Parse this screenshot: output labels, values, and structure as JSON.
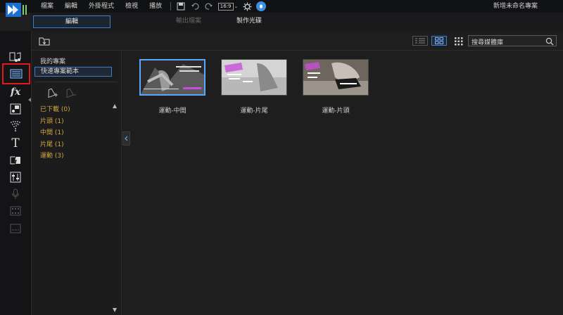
{
  "menubar": {
    "items": [
      "檔案",
      "編輯",
      "外掛程式",
      "檢視",
      "播放"
    ],
    "zoom_label": "16:9",
    "project_title": "新增未命名專案"
  },
  "modes": [
    "編輯",
    "輸出檔案",
    "製作光碟"
  ],
  "rail": {
    "icons": [
      "media-room-icon",
      "template-room-icon",
      "fx-room-icon",
      "pip-room-icon",
      "particle-room-icon",
      "title-room-icon",
      "transition-room-icon",
      "audio-mixing-room-icon",
      "voiceover-room-icon",
      "chapter-room-icon",
      "subtitle-room-icon"
    ]
  },
  "search": {
    "placeholder": "搜尋媒體庫"
  },
  "tags": {
    "header": "我的專案",
    "selected": "快速專案範本",
    "items": [
      "已下載  (0)",
      "片頭  (1)",
      "中間  (1)",
      "片尾  (1)",
      "運動  (3)"
    ]
  },
  "library": {
    "items": [
      {
        "caption": "運動-中間",
        "selected": true,
        "palette": [
          "#3a3a3a",
          "#8a8a8a",
          "#c64fd8"
        ]
      },
      {
        "caption": "運動-片尾",
        "selected": false,
        "palette": [
          "#9a9a9a",
          "#d8d8d8",
          "#c64fd8"
        ]
      },
      {
        "caption": "運動-片頭",
        "selected": false,
        "palette": [
          "#7a6a5a",
          "#c0b8ae",
          "#c64fd8"
        ]
      }
    ]
  },
  "colors": {
    "accent": "#3a7fc8",
    "tag_text": "#d4a542",
    "highlight": "#e01a1a"
  }
}
